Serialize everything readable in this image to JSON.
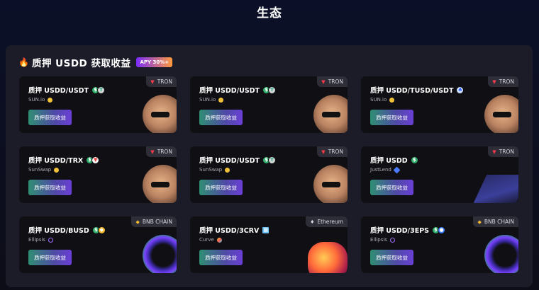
{
  "page_title": "生态",
  "section": {
    "title": "质押 USDD 获取收益",
    "badge": "APY 30%+"
  },
  "colors": {
    "background": "#0c0f22",
    "panel": "#1c1c28",
    "card": "#101014",
    "tron": "#ff3b4b",
    "bnb": "#f3ba2f"
  },
  "cards": [
    {
      "title": "质押 USDD/USDT",
      "protocol": "SUN.io",
      "chain": "TRON",
      "chain_icon": "tron-icon",
      "button": "质押获取收益",
      "coins": [
        "usdd",
        "usdt"
      ]
    },
    {
      "title": "质押 USDD/USDT",
      "protocol": "SUN.io",
      "chain": "TRON",
      "chain_icon": "tron-icon",
      "button": "质押获取收益",
      "coins": [
        "usdd",
        "usdt"
      ]
    },
    {
      "title": "质押 USDD/TUSD/USDT",
      "protocol": "SUN.io",
      "chain": "TRON",
      "chain_icon": "tron-icon",
      "button": "质押获取收益",
      "coins": [
        "tusd-group"
      ]
    },
    {
      "title": "质押 USDD/TRX",
      "protocol": "SunSwap",
      "chain": "TRON",
      "chain_icon": "tron-icon",
      "button": "质押获取收益",
      "coins": [
        "usdd",
        "trx"
      ]
    },
    {
      "title": "质押 USDD/USDT",
      "protocol": "SunSwap",
      "chain": "TRON",
      "chain_icon": "tron-icon",
      "button": "质押获取收益",
      "coins": [
        "usdd",
        "usdt"
      ]
    },
    {
      "title": "质押 USDD",
      "protocol": "JustLend",
      "chain": "TRON",
      "chain_icon": "tron-icon",
      "button": "质押获取收益",
      "coins": [
        "usdd"
      ]
    },
    {
      "title": "质押 USDD/BUSD",
      "protocol": "Ellipsis",
      "chain": "BNB CHAIN",
      "chain_icon": "bnb-icon",
      "button": "质押获取收益",
      "coins": [
        "usdd",
        "busd"
      ]
    },
    {
      "title": "质押 USDD/3CRV",
      "protocol": "Curve",
      "chain": "Ethereum",
      "chain_icon": "ethereum-icon",
      "button": "质押获取收益",
      "coins": [
        "3crv"
      ]
    },
    {
      "title": "质押 USDD/3EPS",
      "protocol": "Ellipsis",
      "chain": "BNB CHAIN",
      "chain_icon": "bnb-icon",
      "button": "质押获取收益",
      "coins": [
        "usdd",
        "3eps"
      ]
    }
  ]
}
